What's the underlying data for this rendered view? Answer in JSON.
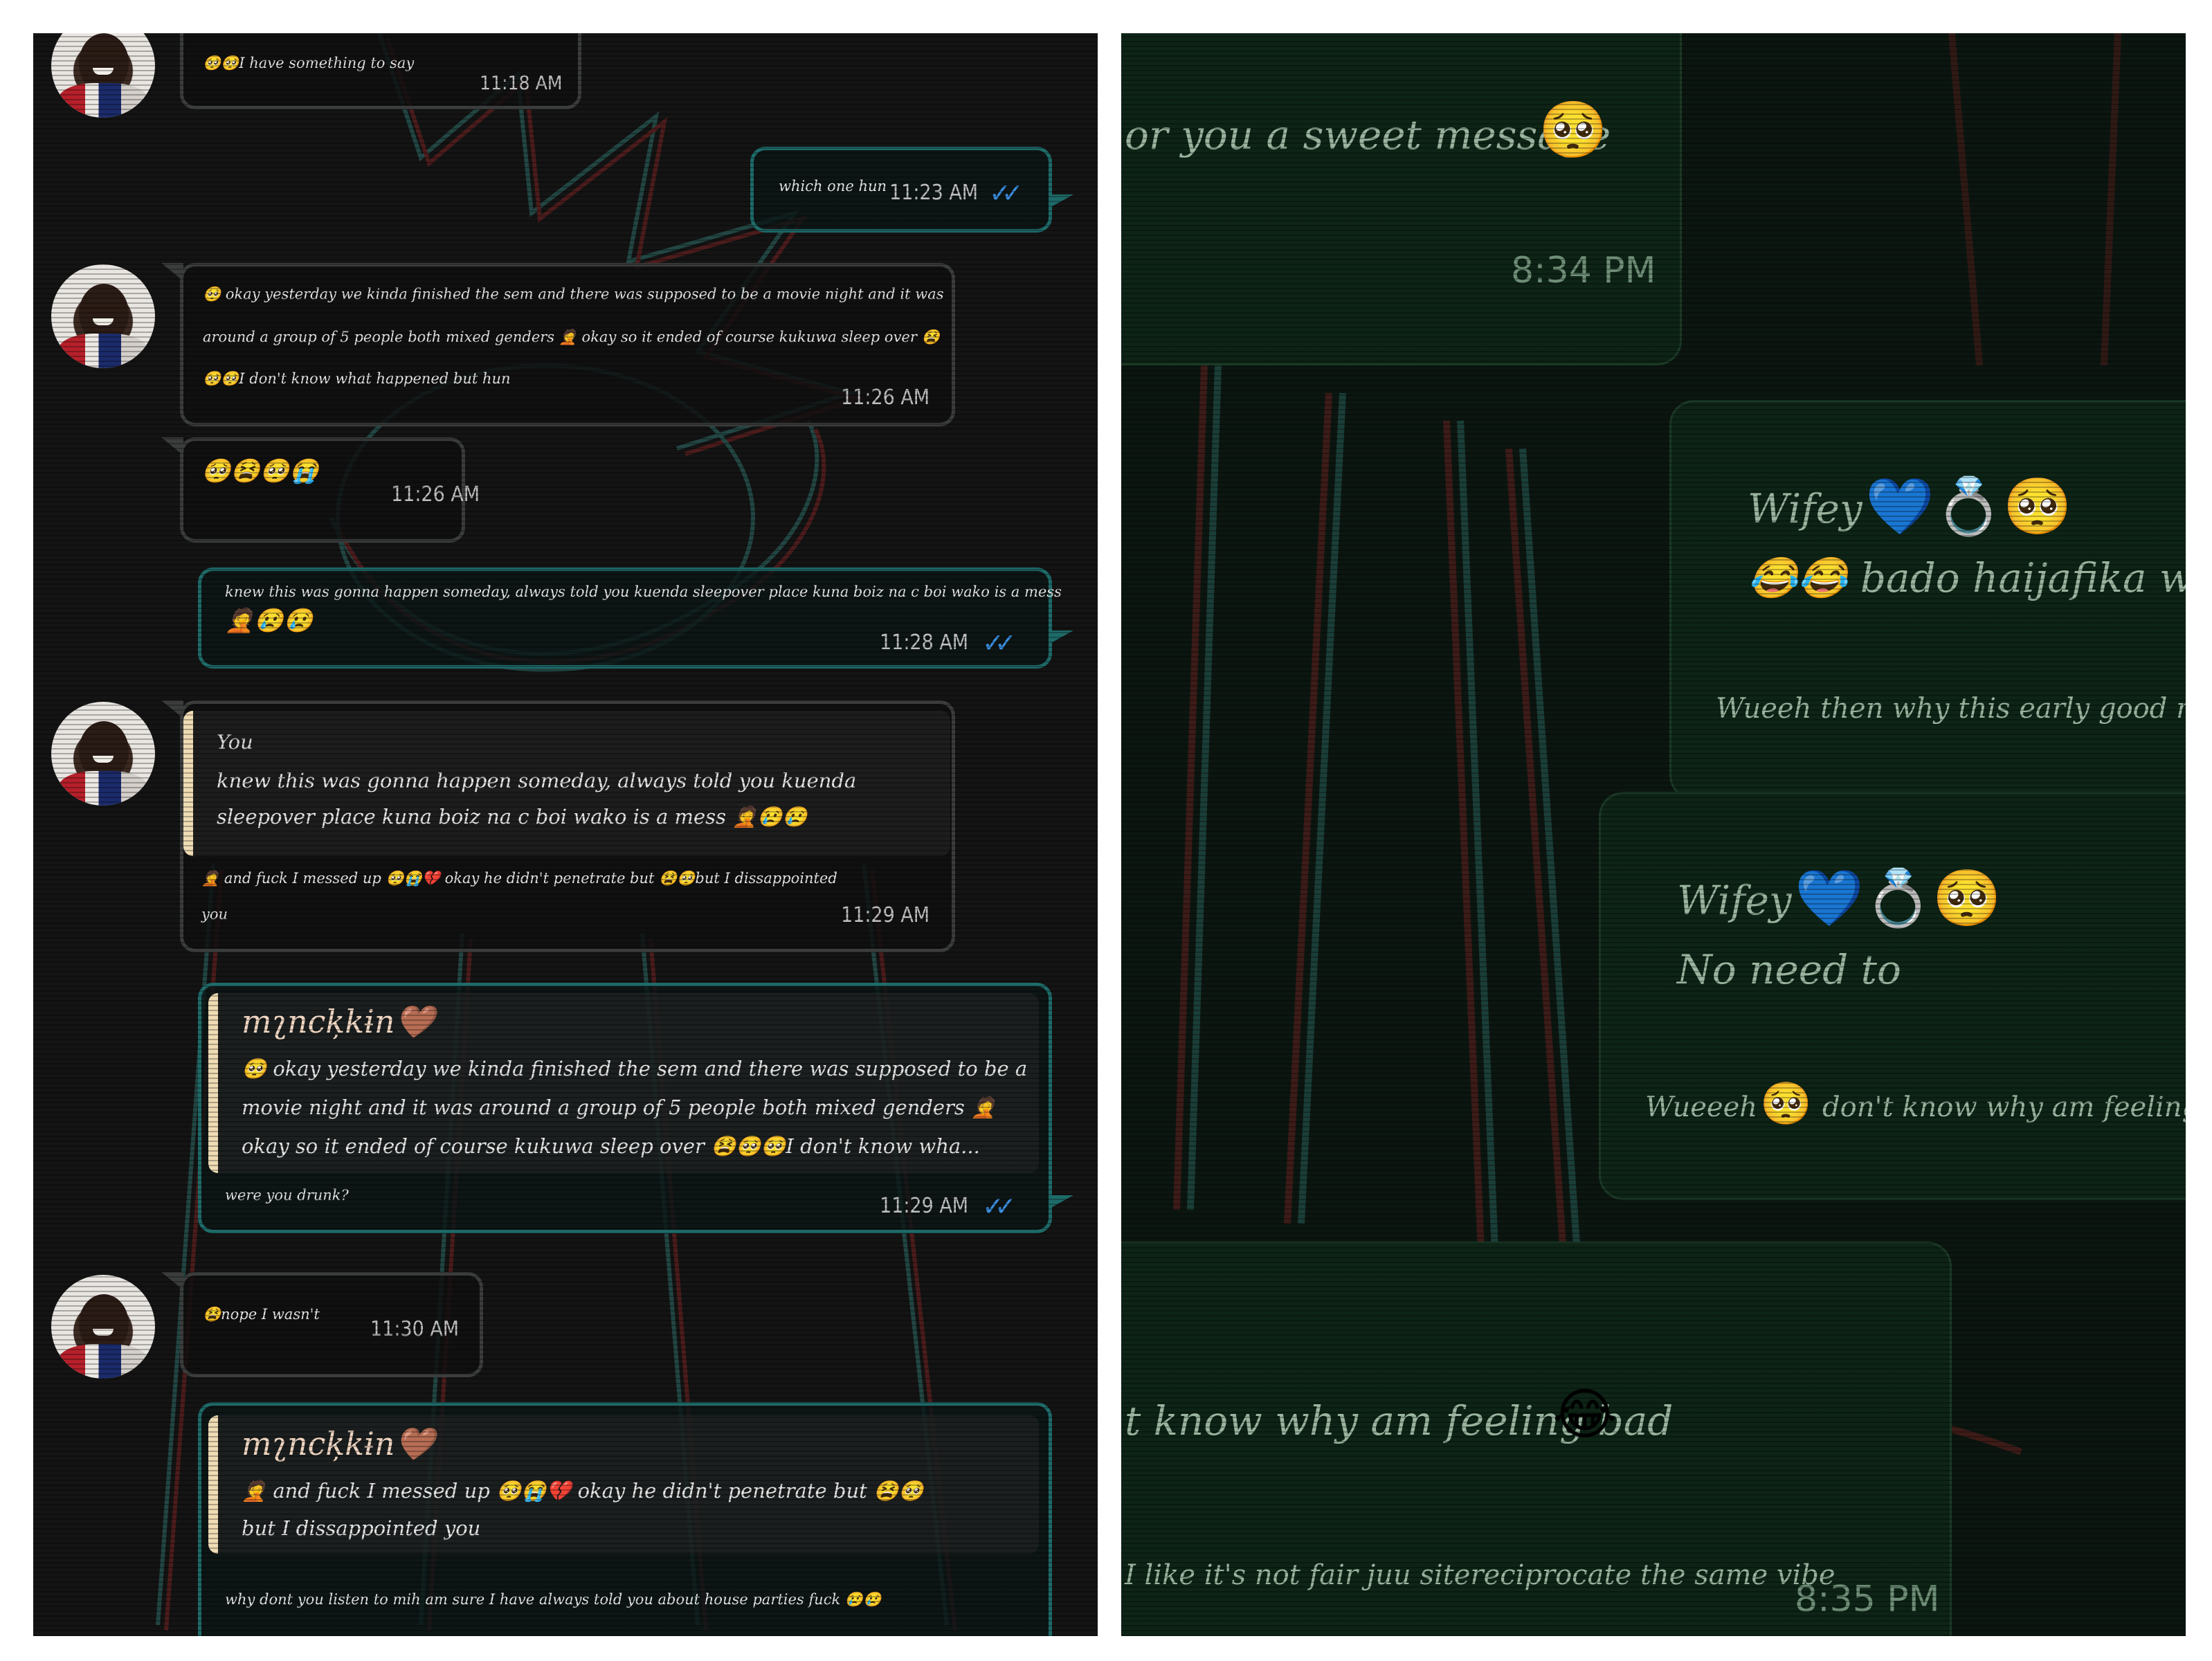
{
  "left": {
    "messages": [
      {
        "text": "🥺🥺I have something to say",
        "time": "11:18 AM"
      },
      {
        "text": "which one hun",
        "time": "11:23 AM",
        "ticks": "✓✓"
      },
      {
        "lines": [
          "🥺 okay yesterday we kinda finished the sem and there was supposed to be a movie night and it was",
          "around a group of 5 people both mixed genders 🤦 okay so it ended of course kukuwa sleep over 😫",
          "🥺🥺I don't know what happened but hun"
        ],
        "time": "11:26 AM"
      },
      {
        "text": "🥺😫🥺😭",
        "time": "11:26 AM"
      },
      {
        "lines": [
          "knew this was gonna happen someday, always told you kuenda sleepover place kuna boiz na c boi wako is a mess",
          "🤦😢😢"
        ],
        "time": "11:28 AM",
        "ticks": "✓✓"
      },
      {
        "quote_name": "You",
        "quote_lines": [
          "knew this was gonna happen someday, always told you kuenda",
          "sleepover place kuna boiz na c boi wako is a mess 🤦😢😢"
        ],
        "lines": [
          "🤦 and fuck I messed up 🥺😭💔 okay he didn't penetrate but 😫🥺but I dissappointed",
          "you"
        ],
        "time": "11:29 AM"
      },
      {
        "quote_name": "mʅncķkɨn🤎",
        "quote_lines": [
          "🥺 okay yesterday we kinda finished the sem and there was supposed to be a",
          "movie night and it was around a group of 5 people both mixed genders 🤦",
          "okay so it ended of course kukuwa sleep over 😫🥺🥺I don't know wha..."
        ],
        "text": "were you drunk?",
        "time": "11:29 AM",
        "ticks": "✓✓"
      },
      {
        "text": "😫nope I wasn't",
        "time": "11:30 AM"
      },
      {
        "quote_name": "mʅncķkɨn🤎",
        "quote_lines": [
          "🤦 and fuck I messed up 🥺😭💔 okay he didn't penetrate but 😫🥺",
          "but I dissappointed you"
        ],
        "text": "why dont you listen to mih am sure I have always told you about house parties fuck 😢😢"
      }
    ]
  },
  "right": {
    "messages": [
      {
        "text": "or you a sweet message",
        "emoji": "🥺",
        "time": "8:34 PM"
      },
      {
        "quote_name": "Wifey",
        "quote_emojis": "💙💍🥺",
        "quote_text": "😂😂 bado haijafika w",
        "text": "Wueeh then why this early good night"
      },
      {
        "quote_name": "Wifey",
        "quote_emojis": "💙💍🥺",
        "quote_text": "No need to",
        "text_a": "Wueeeh",
        "emoji": "🥺",
        "text_b": "don't know why am feeling bad"
      },
      {
        "text": "t know why am feeling bad",
        "emoji": "😂",
        "sub": "I like it's not fair juu sitereciprocate the same vibe",
        "time": "8:35 PM"
      }
    ]
  },
  "colors": {
    "ticks": "#3a8ee0",
    "out_border": "#1e6b69",
    "in_border": "#3b3d3d",
    "quote_bar": "#efdcb5"
  }
}
